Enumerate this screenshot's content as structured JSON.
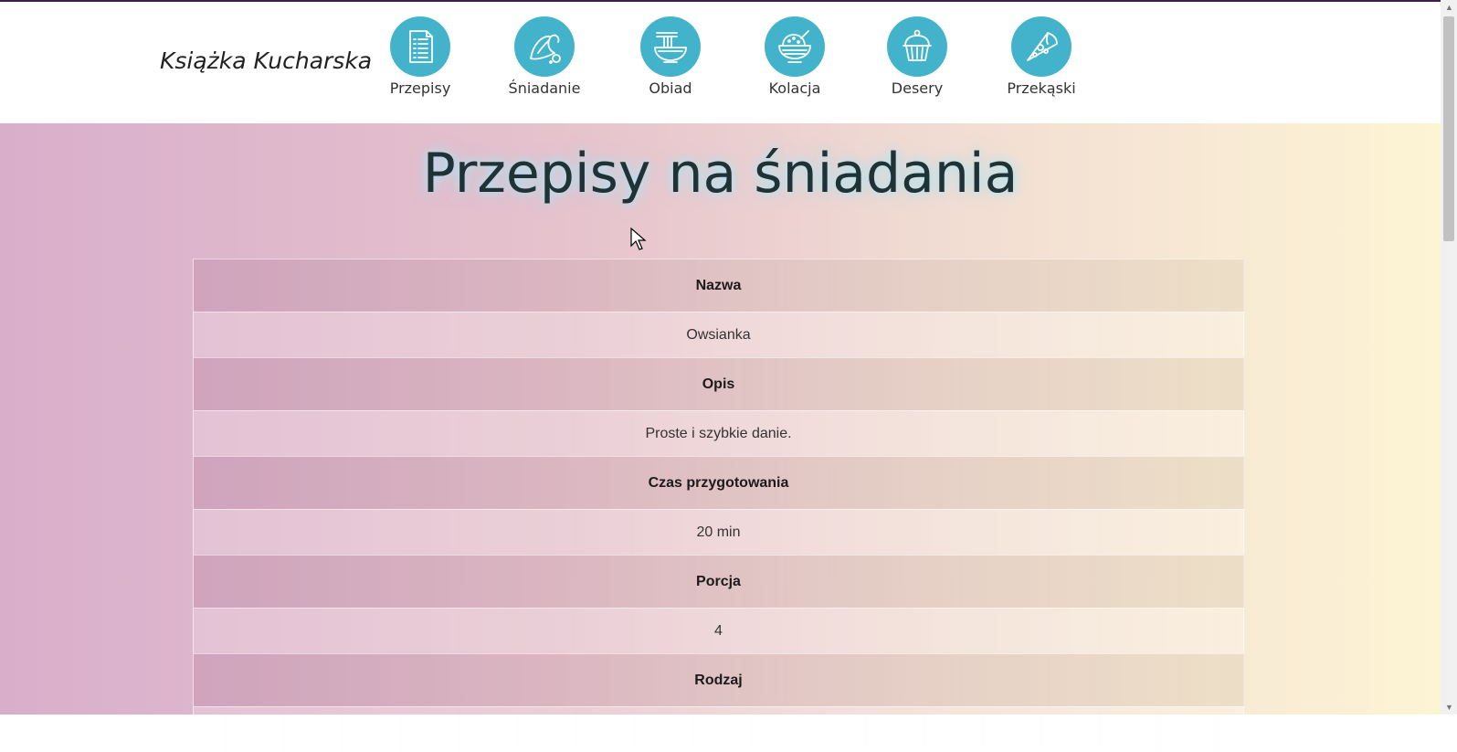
{
  "header": {
    "brand": "Książka Kucharska",
    "nav": [
      {
        "label": "Przepisy",
        "icon": "recipe-list-icon"
      },
      {
        "label": "Śniadanie",
        "icon": "croissant-icon"
      },
      {
        "label": "Obiad",
        "icon": "noodle-bowl-icon"
      },
      {
        "label": "Kolacja",
        "icon": "salad-bowl-icon"
      },
      {
        "label": "Desery",
        "icon": "cupcake-icon"
      },
      {
        "label": "Przekąski",
        "icon": "pizza-slice-icon"
      }
    ]
  },
  "main": {
    "title": "Przepisy na śniadania",
    "table": [
      {
        "header": "Nazwa",
        "value": "Owsianka"
      },
      {
        "header": "Opis",
        "value": "Proste i szybkie danie."
      },
      {
        "header": "Czas przygotowania",
        "value": "20 min"
      },
      {
        "header": "Porcja",
        "value": "4"
      },
      {
        "header": "Rodzaj",
        "value": ""
      }
    ]
  },
  "colors": {
    "nav_circle": "#43b3cc",
    "gradient_left": "#d9aecb",
    "gradient_right": "#fdf4d4",
    "title_text": "#1f3236",
    "top_line": "#3b1d4a"
  }
}
